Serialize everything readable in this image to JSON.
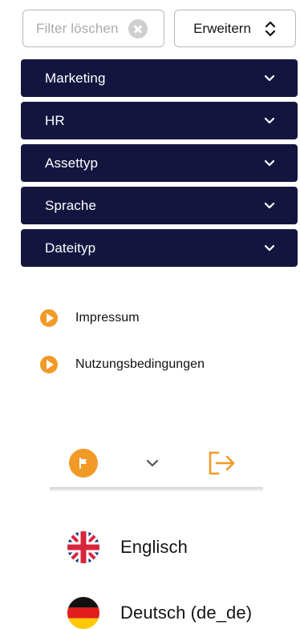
{
  "filters": {
    "clear_label": "Filter löschen",
    "expand_label": "Erweitern"
  },
  "accordion": {
    "items": [
      {
        "label": "Marketing"
      },
      {
        "label": "HR"
      },
      {
        "label": "Assettyp"
      },
      {
        "label": "Sprache"
      },
      {
        "label": "Dateityp"
      }
    ]
  },
  "links": {
    "items": [
      {
        "label": "Impressum"
      },
      {
        "label": "Nutzungsbedingungen"
      }
    ]
  },
  "footer": {
    "language_icon": "flag-icon",
    "chevron_icon": "chevron-down-icon",
    "logout_icon": "logout-icon"
  },
  "language_menu": {
    "options": [
      {
        "label": "Englisch",
        "icon": "uk-flag-icon"
      },
      {
        "label": "Deutsch (de_de)",
        "icon": "de-flag-icon"
      }
    ]
  },
  "colors": {
    "navy": "#14153f",
    "orange": "#f29a27",
    "border": "#b8b8b8",
    "muted_text": "#aaaaaa"
  }
}
